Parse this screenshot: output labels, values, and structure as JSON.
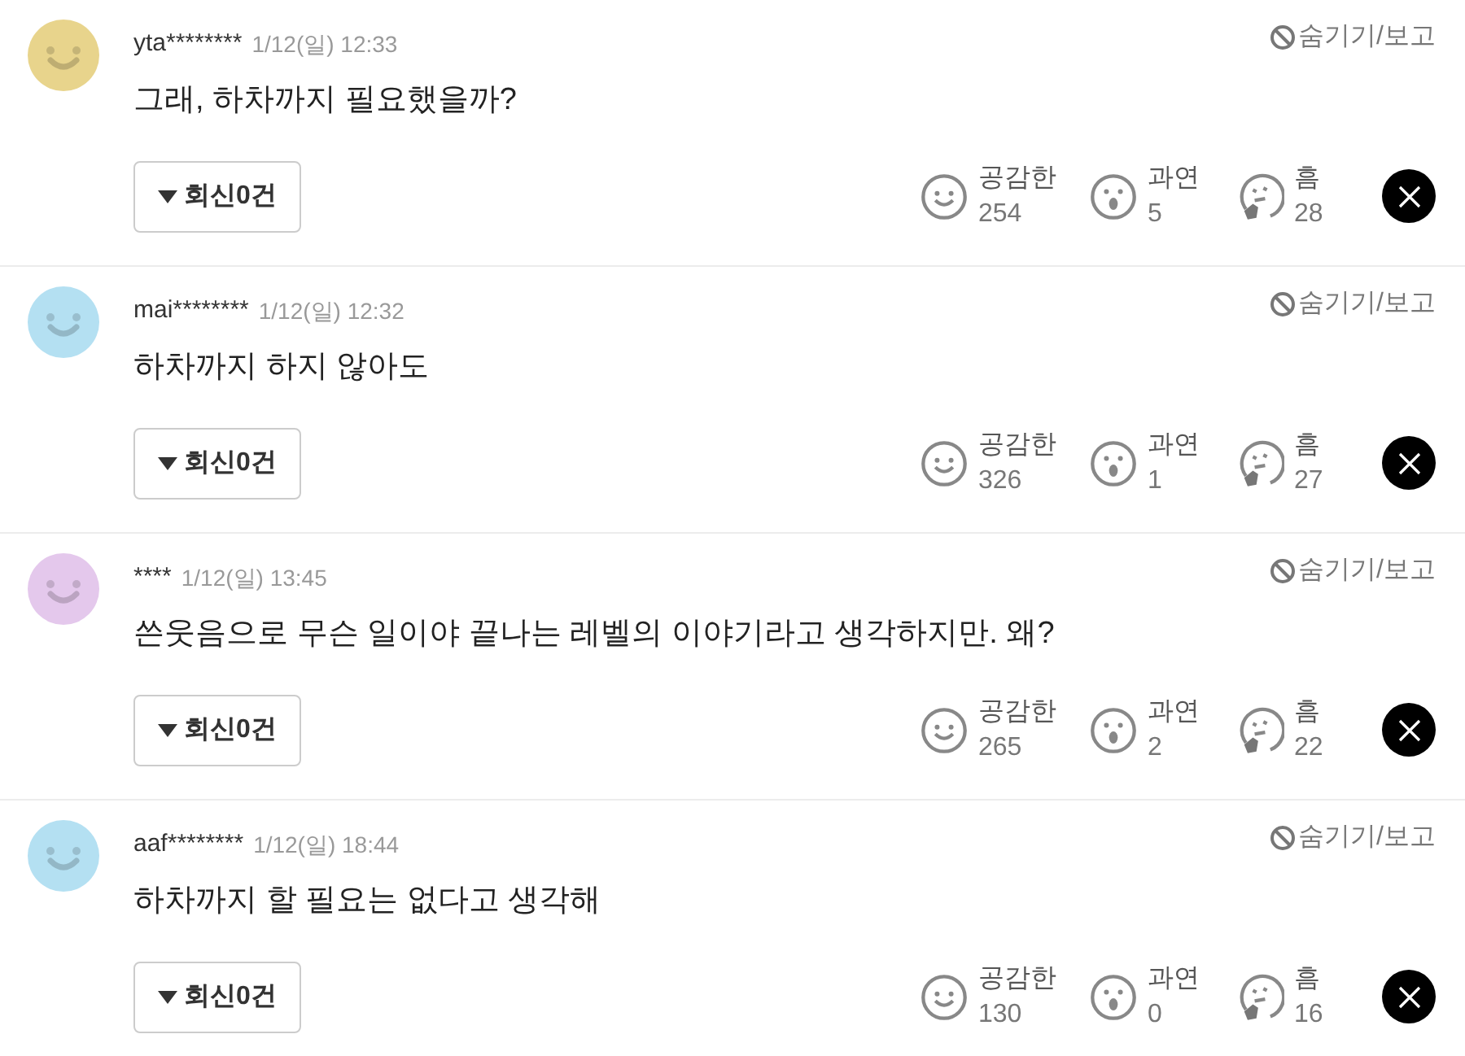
{
  "comments": [
    {
      "color": "#e8d48c",
      "user": "yta********",
      "date": "1/12(일) 12:33",
      "hide": "숨기기/보고",
      "text": "그래, 하차까지 필요했을까?",
      "reply": "회신0건",
      "reactions": [
        {
          "kind": "smile",
          "label": "공감한",
          "count": "254"
        },
        {
          "kind": "surprised",
          "label": "과연",
          "count": "5"
        },
        {
          "kind": "thinking",
          "label": "흠",
          "count": "28"
        }
      ]
    },
    {
      "color": "#b4e0f2",
      "user": "mai********",
      "date": "1/12(일) 12:32",
      "hide": "숨기기/보고",
      "text": "하차까지 하지 않아도",
      "reply": "회신0건",
      "reactions": [
        {
          "kind": "smile",
          "label": "공감한",
          "count": "326"
        },
        {
          "kind": "surprised",
          "label": "과연",
          "count": "1"
        },
        {
          "kind": "thinking",
          "label": "흠",
          "count": "27"
        }
      ]
    },
    {
      "color": "#e4c8ec",
      "user": "****",
      "date": "1/12(일) 13:45",
      "hide": "숨기기/보고",
      "text": "쓴웃음으로 무슨 일이야 끝나는 레벨의 이야기라고 생각하지만. 왜?",
      "reply": "회신0건",
      "reactions": [
        {
          "kind": "smile",
          "label": "공감한",
          "count": "265"
        },
        {
          "kind": "surprised",
          "label": "과연",
          "count": "2"
        },
        {
          "kind": "thinking",
          "label": "흠",
          "count": "22"
        }
      ]
    },
    {
      "color": "#b4e0f2",
      "user": "aaf********",
      "date": "1/12(일) 18:44",
      "hide": "숨기기/보고",
      "text": "하차까지 할 필요는 없다고 생각해",
      "reply": "회신0건",
      "reactions": [
        {
          "kind": "smile",
          "label": "공감한",
          "count": "130"
        },
        {
          "kind": "surprised",
          "label": "과연",
          "count": "0"
        },
        {
          "kind": "thinking",
          "label": "흠",
          "count": "16"
        }
      ]
    }
  ]
}
